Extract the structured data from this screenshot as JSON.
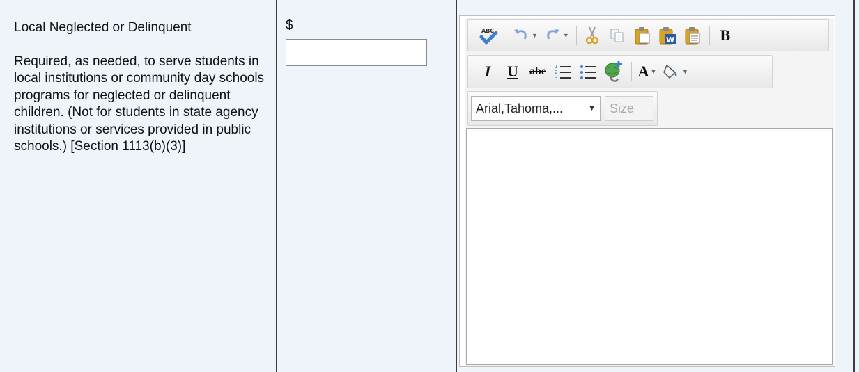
{
  "section": {
    "title": "Local Neglected or Delinquent",
    "description": "Required, as needed, to serve students in local institutions or community day schools programs for neglected or delinquent children. (Not for students in state agency institutions or services provided in public schools.) [Section 1113(b)(3)]"
  },
  "amount": {
    "currency_symbol": "$",
    "value": ""
  },
  "editor": {
    "toolbar_row1": [
      "spellcheck-icon",
      "undo-icon",
      "redo-icon",
      "cut-icon",
      "copy-icon",
      "paste-icon",
      "paste-text-icon",
      "paste-word-icon",
      "paste-special-icon",
      "bold-button"
    ],
    "bold_label": "B",
    "italic_label": "I",
    "underline_label": "U",
    "strike_label": "abe",
    "text_color_label": "A",
    "font_family": "Arial,Tahoma,...",
    "font_size_placeholder": "Size",
    "content": ""
  },
  "colors": {
    "row_background": "#eef4fa",
    "border": "#3c3c3c",
    "icon_blue": "#3f7fd0",
    "icon_gold": "#d8a226",
    "link_green": "#3b8a3a"
  }
}
